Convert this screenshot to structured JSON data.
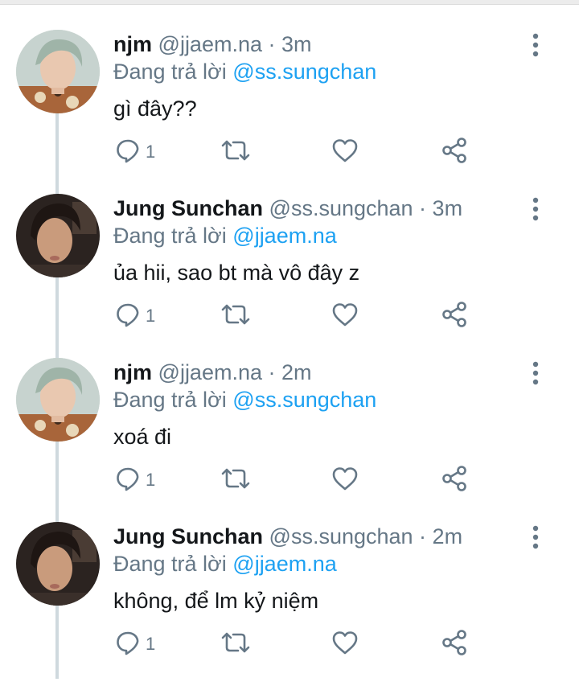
{
  "tweets": [
    {
      "name": "njm",
      "handle": "@jjaem.na",
      "time": "3m",
      "replying_prefix": "Đang trả lời",
      "replying_to": "@ss.sungchan",
      "text": "gì đây??",
      "reply_count": "1",
      "avatar": "avatar-green-hair"
    },
    {
      "name": "Jung Sunchan",
      "handle": "@ss.sungchan",
      "time": "3m",
      "replying_prefix": "Đang trả lời",
      "replying_to": "@jjaem.na",
      "text": "ủa hii, sao bt mà vô đây z",
      "reply_count": "1",
      "avatar": "avatar-dark-hair"
    },
    {
      "name": "njm",
      "handle": "@jjaem.na",
      "time": "2m",
      "replying_prefix": "Đang trả lời",
      "replying_to": "@ss.sungchan",
      "text": "xoá đi",
      "reply_count": "1",
      "avatar": "avatar-green-hair"
    },
    {
      "name": "Jung Sunchan",
      "handle": "@ss.sungchan",
      "time": "2m",
      "replying_prefix": "Đang trả lời",
      "replying_to": "@jjaem.na",
      "text": "không, để lm kỷ niệm",
      "reply_count": "1",
      "avatar": "avatar-dark-hair"
    }
  ],
  "separator": " · ",
  "icons": {
    "reply": "reply-icon",
    "retweet": "retweet-icon",
    "like": "heart-icon",
    "share": "share-icon",
    "more": "more-vertical-icon"
  },
  "colors": {
    "link": "#1da1f2",
    "secondary": "#657786",
    "primary_text": "#14171a",
    "thread_line": "#cfd9de"
  }
}
